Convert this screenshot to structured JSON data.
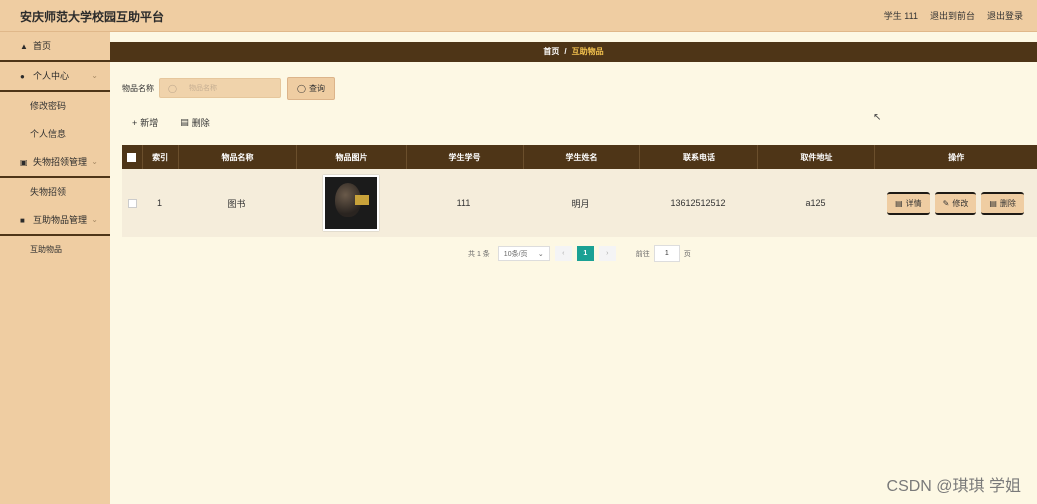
{
  "app": {
    "title": "安庆师范大学校园互助平台"
  },
  "top_right": {
    "user": "学生 111",
    "back_front": "退出到前台",
    "logout": "退出登录"
  },
  "sidebar": {
    "home": "首页",
    "personal": "个人中心",
    "change_password": "修改密码",
    "personal_info": "个人信息",
    "lost_found_mgmt": "失物招领管理",
    "lost_found": "失物招领",
    "mutual_items_mgmt": "互助物品管理",
    "mutual_items": "互助物品"
  },
  "breadcrumb": {
    "home": "首页",
    "sep": "/",
    "current": "互助物品"
  },
  "search": {
    "label": "物品名称",
    "placeholder": "物品名称",
    "button": "查询"
  },
  "actions": {
    "add": "新增",
    "delete": "删除"
  },
  "table": {
    "headers": [
      "索引",
      "物品名称",
      "物品图片",
      "学生学号",
      "学生姓名",
      "联系电话",
      "取件地址",
      "操作"
    ],
    "rows": [
      {
        "index": "1",
        "name": "图书",
        "student_id": "111",
        "student_name": "明月",
        "phone": "13612512512",
        "address": "a125"
      }
    ],
    "op_detail": "详情",
    "op_edit": "修改",
    "op_delete": "删除"
  },
  "pager": {
    "total": "共 1 条",
    "page_size": "10条/页",
    "current": "1",
    "goto_label": "前往",
    "goto_value": "1",
    "page_unit": "页"
  },
  "watermark": "CSDN @琪琪 学姐"
}
